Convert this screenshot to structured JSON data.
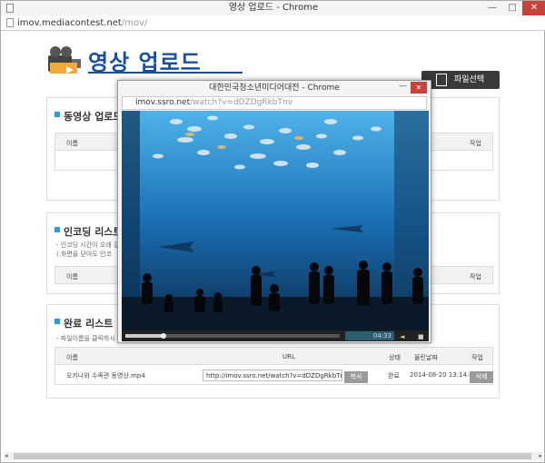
{
  "window": {
    "title": "영상 업로드 - Chrome",
    "url_host": "imov.mediacontest.net",
    "url_path": "/mov/",
    "controls": {
      "minimize": "—",
      "maximize": "□",
      "close": "✕"
    }
  },
  "header": {
    "title": "영상 업로드",
    "file_select_label": "파일선택"
  },
  "sections": {
    "upload": {
      "title": "동영상 업로드",
      "col_name": "이름",
      "col_action": "작업"
    },
    "encoding": {
      "title": "인코딩 리스트",
      "note1": "- 인코딩 시간이 오래 걸",
      "note2": "( 화면을 닫아도 인코",
      "col_name": "이름",
      "col_action": "작업"
    },
    "done": {
      "title": "완료 리스트",
      "note": "- 파일이름을 클릭하시",
      "col_name": "이름",
      "col_url": "URL",
      "col_status": "상태",
      "col_date": "올린날짜",
      "col_action": "작업",
      "rows": [
        {
          "name": "오키나와 수족관 동영상.mp4",
          "url": "http://imov.ssro.net/watch?v=dDZDgRkbTnv",
          "copy": "복사",
          "status": "완료",
          "date": "2014-08-20 13:14:07",
          "delete": "삭제"
        }
      ]
    }
  },
  "popup": {
    "title": "대한민국청소년미디어대전 - Chrome",
    "url_host": "imov.ssro.net",
    "url_path": "/watch?v=dDZDgRkbTnv",
    "minimize": "—",
    "close": "✕",
    "player": {
      "time": "04:33",
      "progress": 0.18,
      "volume_icon": "◄",
      "fullscreen_icon": "■"
    }
  },
  "colors": {
    "accent": "#1a4f9c",
    "bullet": "#2a9fd6",
    "close": "#c9413b",
    "water": "#1b6fb5"
  },
  "icons": [
    "document-icon",
    "camera-clapper-icon",
    "file-icon",
    "volume-icon",
    "fullscreen-icon"
  ]
}
